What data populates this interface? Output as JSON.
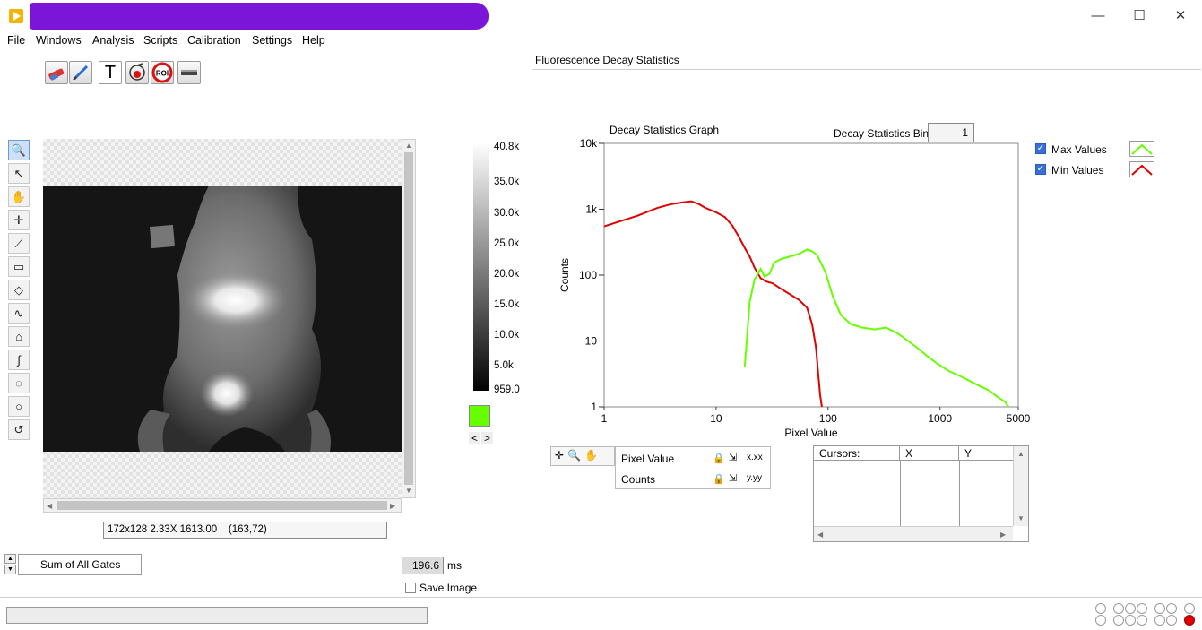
{
  "window": {
    "minimize_icon": "minimize-icon",
    "maximize_icon": "maximize-icon",
    "close_icon": "close-icon",
    "minimize_glyph": "—",
    "maximize_glyph": "☐",
    "close_glyph": "✕"
  },
  "menu": [
    "File",
    "Windows",
    "Analysis",
    "Scripts",
    "Calibration",
    "Settings",
    "Help"
  ],
  "toolbar": {
    "icons": [
      "eraser-icon",
      "pen-icon",
      "text-icon",
      "medical-probe-icon",
      "roi-icon",
      "bar-icon"
    ],
    "text_glyph": "T",
    "roi_label": "ROI"
  },
  "tools": {
    "icons": [
      "zoom-icon",
      "pointer-icon",
      "pan-hand-icon",
      "crosshair-icon",
      "line-icon",
      "rectangle-icon",
      "diamond-icon",
      "polyline-icon",
      "polygon-icon",
      "curve-icon",
      "freehand-icon",
      "ellipse-icon",
      "spiral-icon"
    ],
    "glyphs": [
      "🔍",
      "↖",
      "✋",
      "✛",
      "⟋",
      "▭",
      "◇",
      "∿",
      "⌂",
      "∫",
      "◌",
      "○",
      "↺"
    ]
  },
  "image_info": "172x128 2.33X 1613.00    (163,72)",
  "colorbar": {
    "labels": [
      "40.8k",
      "35.0k",
      "30.0k",
      "25.0k",
      "20.0k",
      "15.0k",
      "10.0k",
      "5.0k",
      "959.0"
    ],
    "swatch_color": "#66ff00",
    "left_arrow": "<",
    "right_arrow": ">"
  },
  "gates": {
    "label": "Sum of All Gates"
  },
  "exposure": {
    "value": "196.6",
    "unit": "ms"
  },
  "save_image": {
    "label": "Save Image",
    "checked": false
  },
  "panel": {
    "title": "Fluorescence Decay Statistics"
  },
  "graph": {
    "title": "Decay Statistics Graph",
    "bin_label": "Decay Statistics Bin",
    "bin_value": "1"
  },
  "legend": {
    "max_label": "Max Values",
    "min_label": "Min Values",
    "max_color": "#66ff00",
    "min_color": "#e00000"
  },
  "axes_panel": {
    "x_label": "Pixel Value",
    "y_label": "Counts",
    "x_format": "x.xx",
    "y_format": "y.yy",
    "lock_icon": "lock-icon"
  },
  "cursors": {
    "headers": [
      "Cursors:",
      "X",
      "Y"
    ]
  },
  "chart_data": {
    "type": "line",
    "title": "",
    "xlabel": "Pixel Value",
    "ylabel": "Counts",
    "x_scale": "log",
    "y_scale": "log",
    "xlim": [
      1,
      5000
    ],
    "ylim": [
      1,
      10000
    ],
    "x_ticks": [
      "1",
      "10",
      "100",
      "1000",
      "5000"
    ],
    "y_ticks": [
      "1",
      "10",
      "100",
      "1k",
      "10k"
    ],
    "series": [
      {
        "name": "Min Values",
        "color": "#e00000",
        "points": [
          [
            1,
            550
          ],
          [
            2,
            800
          ],
          [
            3,
            1050
          ],
          [
            4,
            1200
          ],
          [
            5,
            1270
          ],
          [
            6,
            1320
          ],
          [
            7,
            1200
          ],
          [
            8,
            1050
          ],
          [
            10,
            900
          ],
          [
            12,
            760
          ],
          [
            14,
            560
          ],
          [
            16,
            380
          ],
          [
            18,
            260
          ],
          [
            20,
            190
          ],
          [
            22,
            130
          ],
          [
            25,
            90
          ],
          [
            28,
            80
          ],
          [
            32,
            75
          ],
          [
            38,
            62
          ],
          [
            45,
            52
          ],
          [
            55,
            42
          ],
          [
            65,
            32
          ],
          [
            72,
            18
          ],
          [
            78,
            8
          ],
          [
            82,
            3
          ],
          [
            85,
            1.5
          ],
          [
            88,
            1
          ]
        ]
      },
      {
        "name": "Max Values",
        "color": "#66ff00",
        "points": [
          [
            18,
            4
          ],
          [
            20,
            40
          ],
          [
            22,
            85
          ],
          [
            25,
            125
          ],
          [
            27,
            95
          ],
          [
            30,
            105
          ],
          [
            33,
            155
          ],
          [
            38,
            175
          ],
          [
            45,
            190
          ],
          [
            55,
            210
          ],
          [
            65,
            245
          ],
          [
            72,
            230
          ],
          [
            80,
            200
          ],
          [
            95,
            110
          ],
          [
            110,
            48
          ],
          [
            130,
            25
          ],
          [
            160,
            18
          ],
          [
            200,
            16
          ],
          [
            260,
            15
          ],
          [
            330,
            16
          ],
          [
            420,
            13
          ],
          [
            520,
            10
          ],
          [
            620,
            8
          ],
          [
            760,
            6
          ],
          [
            950,
            4.5
          ],
          [
            1200,
            3.5
          ],
          [
            1600,
            2.8
          ],
          [
            2100,
            2.2
          ],
          [
            2700,
            1.8
          ],
          [
            3300,
            1.4
          ],
          [
            3800,
            1.2
          ],
          [
            4100,
            1
          ]
        ]
      }
    ]
  }
}
